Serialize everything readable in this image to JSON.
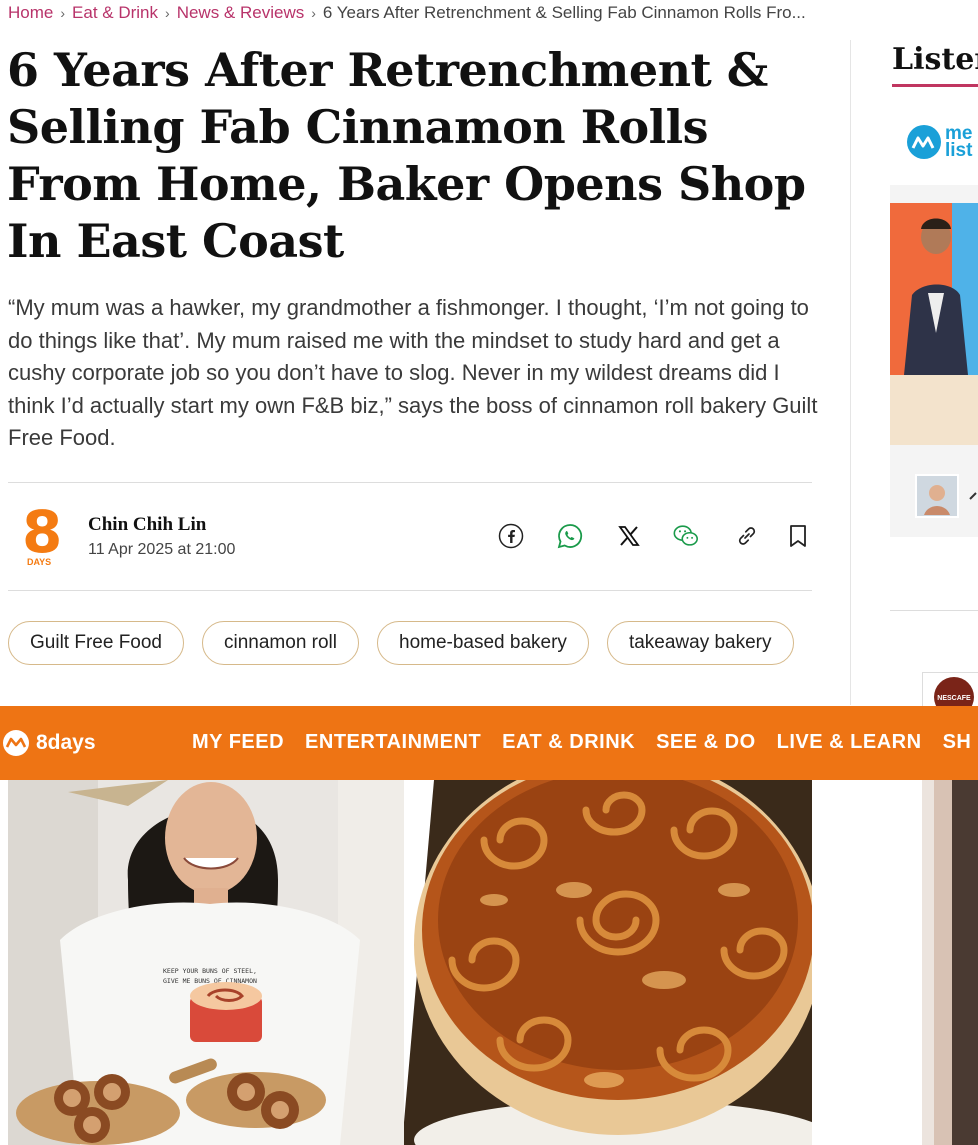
{
  "breadcrumb": [
    "Home",
    "Eat & Drink",
    "News & Reviews",
    "6 Years After Retrenchment & Selling Fab Cinnamon Rolls Fro..."
  ],
  "article": {
    "title": "6 Years After Retrenchment & Selling Fab Cinnamon Rolls From Home, Baker Opens Shop In East Coast",
    "lede": "“My mum was a hawker, my grandmother a fishmonger. I thought, ‘I’m not going to do things like that’. My mum raised me with the mindset to study hard and get a cushy corporate job so you don’t have to slog. Never in my wildest dreams did I think I’d actually start my own F&B biz,” says the boss of cinnamon roll bakery Guilt Free Food.",
    "author": "Chin Chih Lin",
    "date": "11 Apr 2025 at 21:00",
    "publisher_logo": {
      "number": "8",
      "word": "DAYS"
    },
    "tags": [
      "Guilt Free Food",
      "cinnamon roll",
      "home-based bakery",
      "takeaway bakery"
    ],
    "share_icons": [
      "facebook-icon",
      "whatsapp-icon",
      "x-icon",
      "wechat-icon",
      "link-icon",
      "bookmark-icon"
    ],
    "photo_shirt_text": [
      "KEEP YOUR BUNS OF STEEL,",
      "GIVE ME BUNS OF CINNAMON"
    ]
  },
  "sidebar": {
    "title": "Lister",
    "logo_text": [
      "me",
      "list"
    ],
    "badge": "NESCAFE"
  },
  "navbar": {
    "logo": "8days",
    "items": [
      "MY FEED",
      "ENTERTAINMENT",
      "EAT & DRINK",
      "SEE & DO",
      "LIVE & LEARN",
      "SH"
    ]
  },
  "colors": {
    "accent": "#b8336a",
    "brand_orange": "#ee7414",
    "tag_border": "#d6b98a"
  }
}
